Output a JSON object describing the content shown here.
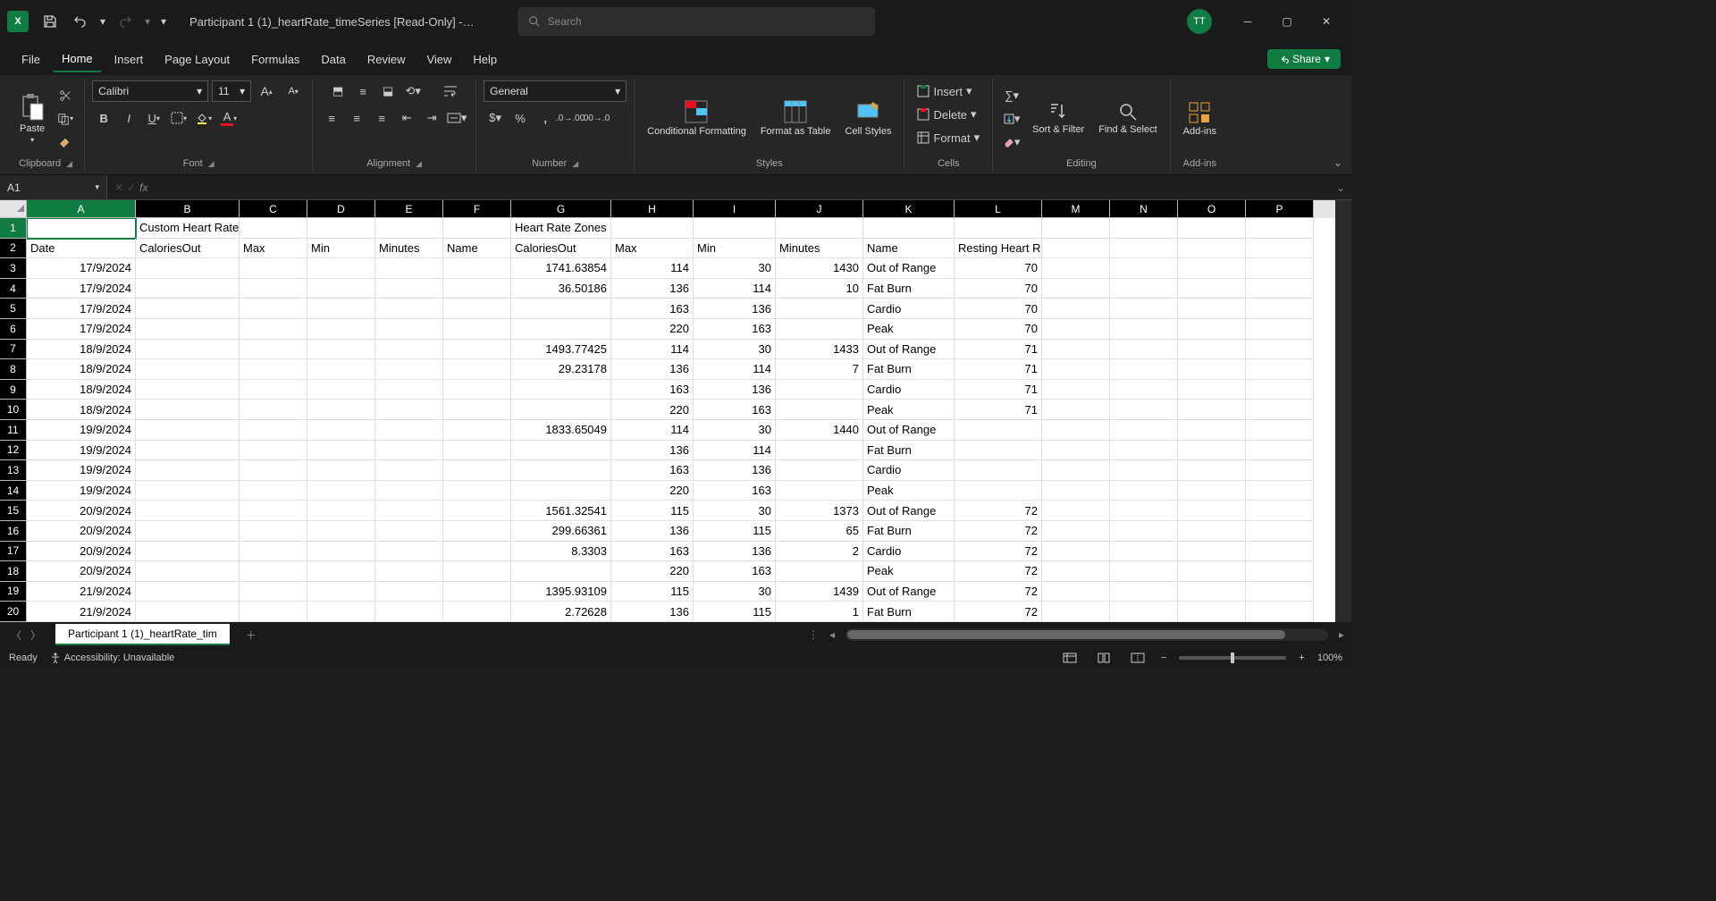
{
  "title": "Participant 1 (1)_heartRate_timeSeries  [Read-Only]  -…",
  "search_placeholder": "Search",
  "user_initials": "TT",
  "tabs": [
    "File",
    "Home",
    "Insert",
    "Page Layout",
    "Formulas",
    "Data",
    "Review",
    "View",
    "Help"
  ],
  "active_tab": "Home",
  "share_label": "Share",
  "ribbon": {
    "paste": "Paste",
    "clipboard": "Clipboard",
    "font_name": "Calibri",
    "font_size": "11",
    "font": "Font",
    "alignment": "Alignment",
    "number_format": "General",
    "number": "Number",
    "cond_fmt": "Conditional Formatting",
    "fmt_table": "Format as Table",
    "cell_styles": "Cell Styles",
    "styles": "Styles",
    "insert": "Insert",
    "delete": "Delete",
    "format": "Format",
    "cells": "Cells",
    "sort_filter": "Sort & Filter",
    "find_select": "Find & Select",
    "editing": "Editing",
    "addins": "Add-ins"
  },
  "name_box": "A1",
  "formula_value": "",
  "columns": [
    "A",
    "B",
    "C",
    "D",
    "E",
    "F",
    "G",
    "H",
    "I",
    "J",
    "K",
    "L",
    "M",
    "N",
    "O",
    "P"
  ],
  "col_widths": [
    "cA",
    "cB",
    "cC",
    "cD",
    "cE",
    "cF",
    "cG",
    "cH",
    "cI",
    "cJ",
    "cK",
    "cL",
    "cM",
    "cN",
    "cO",
    "cP"
  ],
  "rows": [
    {
      "n": 1,
      "cells": [
        "",
        "Custom Heart Rate Zones",
        "",
        "",
        "",
        "",
        "Heart Rate Zones",
        "",
        "",
        "",
        "",
        "",
        "",
        "",
        "",
        ""
      ]
    },
    {
      "n": 2,
      "cells": [
        "Date",
        "CaloriesOut",
        "Max",
        "Min",
        "Minutes",
        "Name",
        "CaloriesOut",
        "Max",
        "Min",
        "Minutes",
        "Name",
        "Resting Heart Rate",
        "",
        "",
        "",
        ""
      ]
    },
    {
      "n": 3,
      "cells": [
        "17/9/2024",
        "",
        "",
        "",
        "",
        "",
        "1741.63854",
        "114",
        "30",
        "1430",
        "Out of Range",
        "70",
        "",
        "",
        "",
        ""
      ]
    },
    {
      "n": 4,
      "cells": [
        "17/9/2024",
        "",
        "",
        "",
        "",
        "",
        "36.50186",
        "136",
        "114",
        "10",
        "Fat Burn",
        "70",
        "",
        "",
        "",
        ""
      ]
    },
    {
      "n": 5,
      "cells": [
        "17/9/2024",
        "",
        "",
        "",
        "",
        "",
        "",
        "163",
        "136",
        "",
        "Cardio",
        "70",
        "",
        "",
        "",
        ""
      ]
    },
    {
      "n": 6,
      "cells": [
        "17/9/2024",
        "",
        "",
        "",
        "",
        "",
        "",
        "220",
        "163",
        "",
        "Peak",
        "70",
        "",
        "",
        "",
        ""
      ]
    },
    {
      "n": 7,
      "cells": [
        "18/9/2024",
        "",
        "",
        "",
        "",
        "",
        "1493.77425",
        "114",
        "30",
        "1433",
        "Out of Range",
        "71",
        "",
        "",
        "",
        ""
      ]
    },
    {
      "n": 8,
      "cells": [
        "18/9/2024",
        "",
        "",
        "",
        "",
        "",
        "29.23178",
        "136",
        "114",
        "7",
        "Fat Burn",
        "71",
        "",
        "",
        "",
        ""
      ]
    },
    {
      "n": 9,
      "cells": [
        "18/9/2024",
        "",
        "",
        "",
        "",
        "",
        "",
        "163",
        "136",
        "",
        "Cardio",
        "71",
        "",
        "",
        "",
        ""
      ]
    },
    {
      "n": 10,
      "cells": [
        "18/9/2024",
        "",
        "",
        "",
        "",
        "",
        "",
        "220",
        "163",
        "",
        "Peak",
        "71",
        "",
        "",
        "",
        ""
      ]
    },
    {
      "n": 11,
      "cells": [
        "19/9/2024",
        "",
        "",
        "",
        "",
        "",
        "1833.65049",
        "114",
        "30",
        "1440",
        "Out of Range",
        "",
        "",
        "",
        "",
        ""
      ]
    },
    {
      "n": 12,
      "cells": [
        "19/9/2024",
        "",
        "",
        "",
        "",
        "",
        "",
        "136",
        "114",
        "",
        "Fat Burn",
        "",
        "",
        "",
        "",
        ""
      ]
    },
    {
      "n": 13,
      "cells": [
        "19/9/2024",
        "",
        "",
        "",
        "",
        "",
        "",
        "163",
        "136",
        "",
        "Cardio",
        "",
        "",
        "",
        "",
        ""
      ]
    },
    {
      "n": 14,
      "cells": [
        "19/9/2024",
        "",
        "",
        "",
        "",
        "",
        "",
        "220",
        "163",
        "",
        "Peak",
        "",
        "",
        "",
        "",
        ""
      ]
    },
    {
      "n": 15,
      "cells": [
        "20/9/2024",
        "",
        "",
        "",
        "",
        "",
        "1561.32541",
        "115",
        "30",
        "1373",
        "Out of Range",
        "72",
        "",
        "",
        "",
        ""
      ]
    },
    {
      "n": 16,
      "cells": [
        "20/9/2024",
        "",
        "",
        "",
        "",
        "",
        "299.66361",
        "136",
        "115",
        "65",
        "Fat Burn",
        "72",
        "",
        "",
        "",
        ""
      ]
    },
    {
      "n": 17,
      "cells": [
        "20/9/2024",
        "",
        "",
        "",
        "",
        "",
        "8.3303",
        "163",
        "136",
        "2",
        "Cardio",
        "72",
        "",
        "",
        "",
        ""
      ]
    },
    {
      "n": 18,
      "cells": [
        "20/9/2024",
        "",
        "",
        "",
        "",
        "",
        "",
        "220",
        "163",
        "",
        "Peak",
        "72",
        "",
        "",
        "",
        ""
      ]
    },
    {
      "n": 19,
      "cells": [
        "21/9/2024",
        "",
        "",
        "",
        "",
        "",
        "1395.93109",
        "115",
        "30",
        "1439",
        "Out of Range",
        "72",
        "",
        "",
        "",
        ""
      ]
    },
    {
      "n": 20,
      "cells": [
        "21/9/2024",
        "",
        "",
        "",
        "",
        "",
        "2.72628",
        "136",
        "115",
        "1",
        "Fat Burn",
        "72",
        "",
        "",
        "",
        ""
      ]
    }
  ],
  "numeric_cols": [
    0,
    6,
    7,
    8,
    9,
    11
  ],
  "text_override_rows": [
    1,
    2
  ],
  "sheet_tab": "Participant 1 (1)_heartRate_tim",
  "status": {
    "ready": "Ready",
    "accessibility": "Accessibility: Unavailable",
    "zoom": "100%"
  }
}
